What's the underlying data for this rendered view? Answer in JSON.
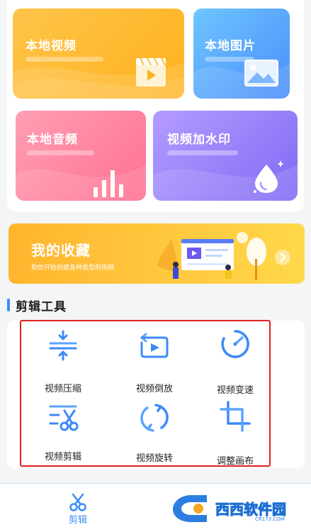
{
  "cards": {
    "local_video": "本地视频",
    "local_image": "本地图片",
    "local_audio": "本地音频",
    "video_watermark": "视频加水印"
  },
  "favorites": {
    "title": "我的收藏",
    "subtitle": "助你开始创建各种类型的视频"
  },
  "section": {
    "title": "剪辑工具"
  },
  "tools": [
    {
      "label": "视频压缩",
      "icon": "compress-icon"
    },
    {
      "label": "视频倒放",
      "icon": "reverse-play-icon"
    },
    {
      "label": "视频变速",
      "icon": "speed-gauge-icon"
    },
    {
      "label": "视频剪辑",
      "icon": "scissors-icon"
    },
    {
      "label": "视频旋转",
      "icon": "rotate-icon"
    },
    {
      "label": "调整画布",
      "icon": "crop-canvas-icon"
    }
  ],
  "nav": {
    "edit_label": "剪辑"
  },
  "watermark": {
    "text": "西西软件园",
    "sub": "CR173.COM"
  },
  "colors": {
    "accent": "#3d8af7",
    "highlight": "#e02020",
    "video_card": "#ffb21e",
    "image_card": "#4a8dfb",
    "audio_card": "#ff6f91",
    "watermark_card": "#8169f5",
    "favorites_banner": "#ffc43a"
  }
}
